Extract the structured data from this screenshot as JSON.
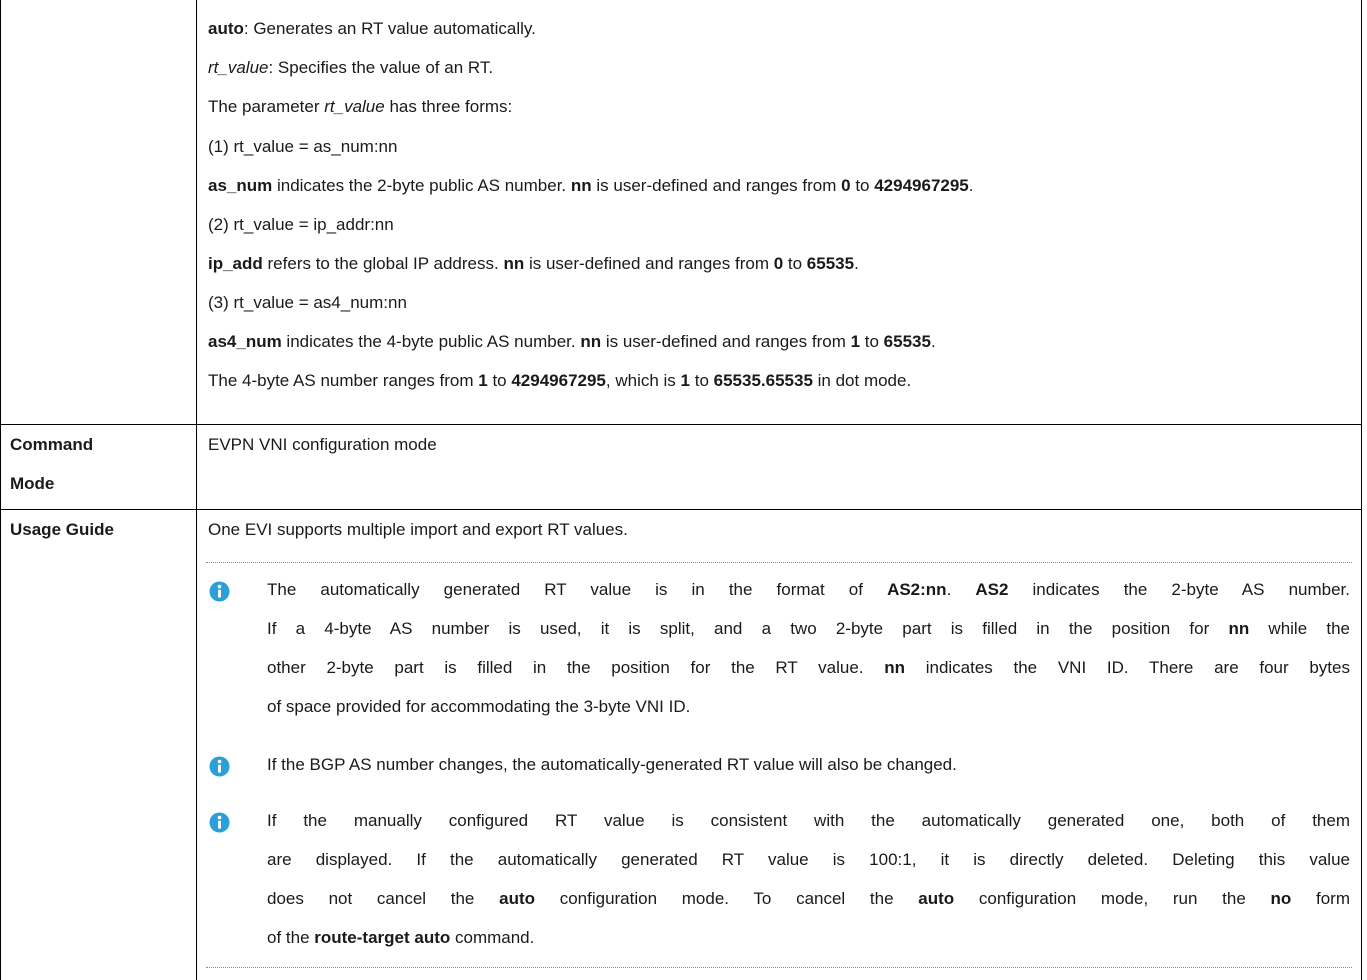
{
  "param_block": {
    "auto_kw": "auto",
    "auto_desc": ": Generates an RT value automatically.",
    "rt_value_kw": "rt_value",
    "rt_value_desc": ": Specifies the value of an RT.",
    "forms_pre": "The parameter ",
    "forms_kw": "rt_value",
    "forms_post": " has three forms:",
    "form1": "(1) rt_value = as_num:nn",
    "as_num_line": {
      "kw1": "as_num",
      "t1": " indicates the 2-byte public AS number. ",
      "kw2": "nn",
      "t2": " is user-defined and ranges from ",
      "kw3": "0",
      "t3": " to ",
      "kw4": "4294967295",
      "t4": "."
    },
    "form2": "(2) rt_value = ip_addr:nn",
    "ip_add_line": {
      "kw1": "ip_add",
      "t1": " refers to the global IP address. ",
      "kw2": "nn",
      "t2": " is user-defined and ranges from ",
      "kw3": "0",
      "t3": " to ",
      "kw4": "65535",
      "t4": "."
    },
    "form3": "(3) rt_value = as4_num:nn",
    "as4_num_line": {
      "kw1": "as4_num",
      "t1": " indicates the 4-byte public AS number. ",
      "kw2": "nn",
      "t2": " is user-defined and ranges from ",
      "kw3": "1",
      "t3": " to ",
      "kw4": "65535",
      "t4": "."
    },
    "dot_mode_line": {
      "t0": "The 4-byte AS number ranges from ",
      "kw1": "1",
      "t1": " to ",
      "kw2": "4294967295",
      "t2": ", which is ",
      "kw3": "1",
      "t3": " to ",
      "kw4": "65535.65535",
      "t4": " in dot mode."
    }
  },
  "command_mode": {
    "label_line1": "Command",
    "label_line2": "Mode",
    "value": "EVPN VNI configuration mode"
  },
  "usage_guide": {
    "label": "Usage Guide",
    "intro": "One EVI supports multiple import and export RT values.",
    "note1": {
      "l1_t0": "The automatically generated RT value is in the format of ",
      "l1_kw1": "AS2:nn",
      "l1_t1": ". ",
      "l1_kw2": "AS2",
      "l1_t2": " indicates the 2-byte AS number.",
      "l2_t0": "If a 4-byte AS number is used, it is split, and a two 2-byte part is filled in the position for ",
      "l2_kw1": "nn",
      "l2_t1": " while the",
      "l3_t0": "other 2-byte part is filled in the position for the RT value. ",
      "l3_kw1": "nn",
      "l3_t1": " indicates the VNI ID. There are four bytes",
      "l4": "of space provided for accommodating the 3-byte VNI ID."
    },
    "note2": "If the BGP AS number changes, the automatically-generated RT value will also be changed.",
    "note3": {
      "l1": "If the manually configured RT value is consistent with the automatically generated one, both of them",
      "l2": "are displayed. If the automatically generated RT value is 100:1, it is directly deleted. Deleting this value",
      "l3_t0": "does not cancel the ",
      "l3_kw1": "auto",
      "l3_t1": " configuration mode. To cancel the ",
      "l3_kw2": "auto",
      "l3_t2": " configuration mode, run the ",
      "l3_kw3": "no",
      "l3_t3": " form",
      "l4_t0": "of the ",
      "l4_kw1": "route-target auto",
      "l4_t1": " command."
    }
  },
  "colors": {
    "info_icon": "#2a9fd8",
    "border": "#000000",
    "dotted_separator": "#8a8a8a"
  },
  "icons": {
    "note_icon": "info-icon"
  }
}
